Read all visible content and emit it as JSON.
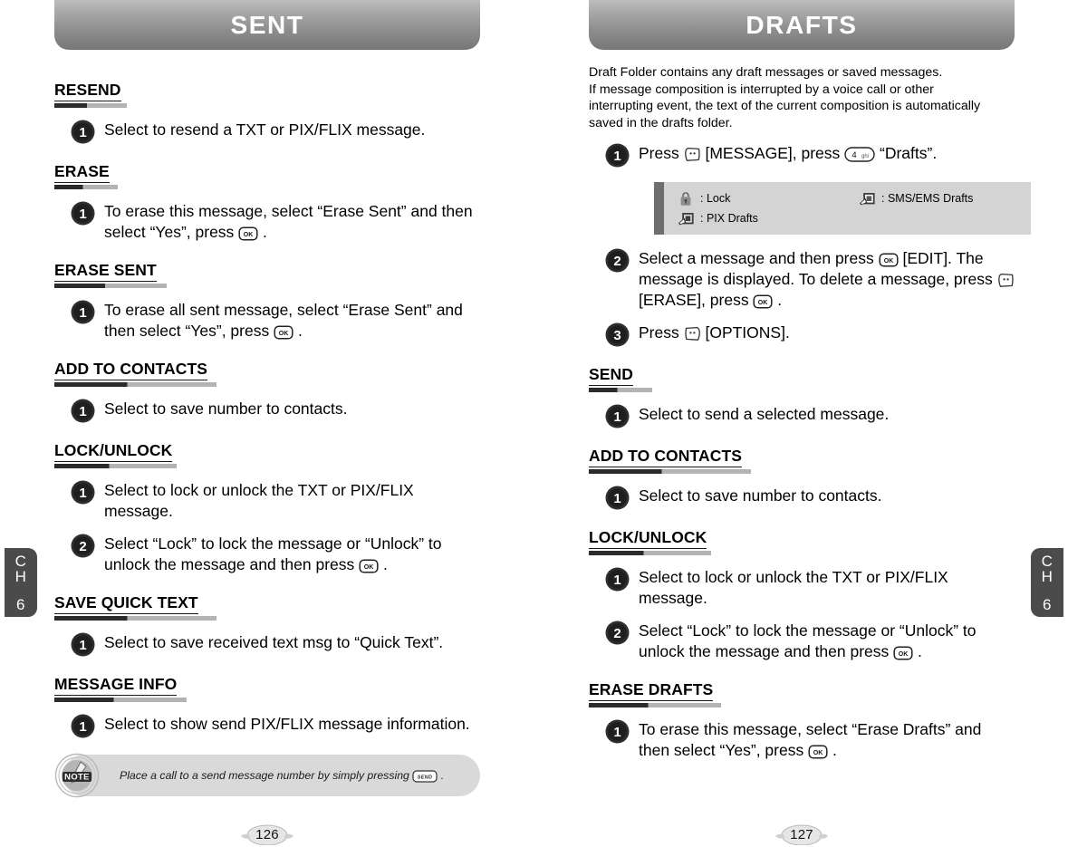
{
  "chapter_tabs": {
    "left": {
      "line1": "C",
      "line2": "H",
      "number": "6"
    },
    "right": {
      "line1": "C",
      "line2": "H",
      "number": "6"
    }
  },
  "colors": {
    "banner_top": "#bdbdbd",
    "banner_bottom": "#767676",
    "rule_dark": "#2b2b2b",
    "rule_light": "#b3b3b3",
    "legend_bg": "#d4d4d4",
    "legend_bar": "#6e6e6e",
    "note_bg": "#d9d9d9",
    "tab_bg": "#4b4b4b"
  },
  "left_page": {
    "banner_title": "SENT",
    "page_number": "126",
    "sections": [
      {
        "title": "RESEND",
        "steps": [
          {
            "num": "1",
            "parts": [
              {
                "t": "text",
                "v": "Select to resend a TXT or PIX/FLIX message."
              }
            ]
          }
        ]
      },
      {
        "title": "ERASE",
        "steps": [
          {
            "num": "1",
            "parts": [
              {
                "t": "text",
                "v": "To erase this message, select “Erase Sent” and then select “Yes”, press "
              },
              {
                "t": "key",
                "v": "ok-key"
              },
              {
                "t": "text",
                "v": " ."
              }
            ]
          }
        ]
      },
      {
        "title": "ERASE SENT",
        "steps": [
          {
            "num": "1",
            "parts": [
              {
                "t": "text",
                "v": "To erase all sent message, select “Erase Sent” and then select “Yes”, press "
              },
              {
                "t": "key",
                "v": "ok-key"
              },
              {
                "t": "text",
                "v": " ."
              }
            ]
          }
        ]
      },
      {
        "title": "ADD TO CONTACTS",
        "steps": [
          {
            "num": "1",
            "parts": [
              {
                "t": "text",
                "v": "Select to save number to contacts."
              }
            ]
          }
        ]
      },
      {
        "title": "LOCK/UNLOCK",
        "steps": [
          {
            "num": "1",
            "parts": [
              {
                "t": "text",
                "v": "Select to lock or unlock the TXT or PIX/FLIX message."
              }
            ]
          },
          {
            "num": "2",
            "parts": [
              {
                "t": "text",
                "v": "Select “Lock” to lock the message or “Unlock” to unlock the message and then press "
              },
              {
                "t": "key",
                "v": "ok-key"
              },
              {
                "t": "text",
                "v": " ."
              }
            ]
          }
        ]
      },
      {
        "title": "SAVE QUICK TEXT",
        "steps": [
          {
            "num": "1",
            "parts": [
              {
                "t": "text",
                "v": "Select to save received text msg to “Quick Text”."
              }
            ]
          }
        ]
      },
      {
        "title": "MESSAGE INFO",
        "steps": [
          {
            "num": "1",
            "parts": [
              {
                "t": "text",
                "v": "Select to show send PIX/FLIX message information."
              }
            ]
          }
        ]
      }
    ],
    "note": {
      "badge_label": "NOTE",
      "parts": [
        {
          "t": "text",
          "v": "Place a call to a send message number by simply pressing "
        },
        {
          "t": "key",
          "v": "send-key"
        },
        {
          "t": "text",
          "v": " ."
        }
      ]
    }
  },
  "right_page": {
    "banner_title": "DRAFTS",
    "page_number": "127",
    "intro": "Draft Folder contains any draft messages or saved messages.\nIf message composition is interrupted by a voice call or other\ninterrupting event, the text of the current composition is automatically\nsaved in the drafts folder.",
    "top_steps": [
      {
        "num": "1",
        "parts": [
          {
            "t": "text",
            "v": "Press "
          },
          {
            "t": "key",
            "v": "left-soft-key"
          },
          {
            "t": "text",
            "v": " [MESSAGE], press "
          },
          {
            "t": "key",
            "v": "key-4-ghi"
          },
          {
            "t": "text",
            "v": " “Drafts”."
          }
        ]
      }
    ],
    "legend": [
      {
        "icon": "lock-icon",
        "label": ": Lock"
      },
      {
        "icon": "sms-ems-icon",
        "label": ": SMS/EMS Drafts"
      },
      {
        "icon": "pix-drafts-icon",
        "label": ": PIX Drafts"
      }
    ],
    "mid_steps": [
      {
        "num": "2",
        "parts": [
          {
            "t": "text",
            "v": "Select a message and then press "
          },
          {
            "t": "key",
            "v": "ok-key"
          },
          {
            "t": "text",
            "v": " [EDIT]. The message is displayed. To delete a message, press "
          },
          {
            "t": "key",
            "v": "left-soft-key"
          },
          {
            "t": "text",
            "v": " [ERASE], press "
          },
          {
            "t": "key",
            "v": "ok-key"
          },
          {
            "t": "text",
            "v": " ."
          }
        ]
      },
      {
        "num": "3",
        "parts": [
          {
            "t": "text",
            "v": "Press "
          },
          {
            "t": "key",
            "v": "right-soft-key"
          },
          {
            "t": "text",
            "v": " [OPTIONS]."
          }
        ]
      }
    ],
    "sections": [
      {
        "title": "SEND",
        "steps": [
          {
            "num": "1",
            "parts": [
              {
                "t": "text",
                "v": "Select to send a selected message."
              }
            ]
          }
        ]
      },
      {
        "title": "ADD TO CONTACTS",
        "steps": [
          {
            "num": "1",
            "parts": [
              {
                "t": "text",
                "v": "Select to save number to contacts."
              }
            ]
          }
        ]
      },
      {
        "title": "LOCK/UNLOCK",
        "steps": [
          {
            "num": "1",
            "parts": [
              {
                "t": "text",
                "v": "Select to lock or unlock the TXT or PIX/FLIX message."
              }
            ]
          },
          {
            "num": "2",
            "parts": [
              {
                "t": "text",
                "v": "Select “Lock” to lock the message or “Unlock” to unlock the message and then press "
              },
              {
                "t": "key",
                "v": "ok-key"
              },
              {
                "t": "text",
                "v": " ."
              }
            ]
          }
        ]
      },
      {
        "title": "ERASE DRAFTS",
        "steps": [
          {
            "num": "1",
            "parts": [
              {
                "t": "text",
                "v": "To erase this message, select “Erase Drafts” and then select “Yes”, press "
              },
              {
                "t": "key",
                "v": "ok-key"
              },
              {
                "t": "text",
                "v": " ."
              }
            ]
          }
        ]
      }
    ]
  },
  "key_labels": {
    "ok-key": "OK",
    "send-key": "SEND",
    "key-4-ghi": {
      "digit": "4",
      "letters": "ghi"
    }
  }
}
